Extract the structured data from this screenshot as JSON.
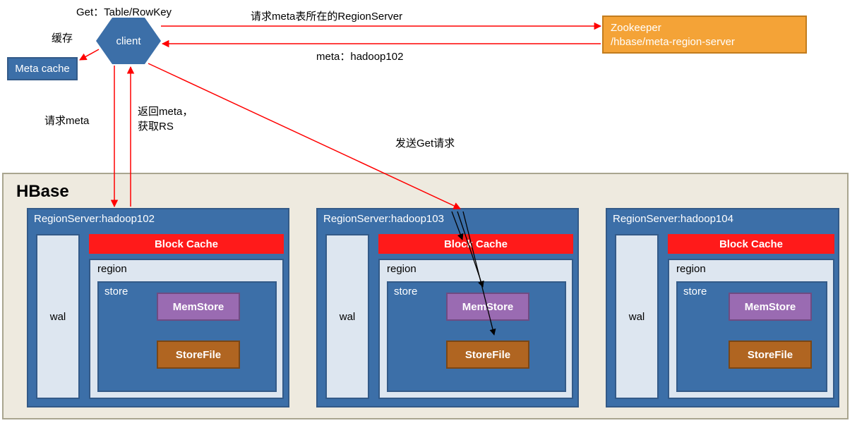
{
  "top": {
    "get_label": "Get：Table/RowKey",
    "req_zk": "请求meta表所在的RegionServer",
    "cache_label": "缓存",
    "client": "client",
    "meta_return": "meta：hadoop102",
    "zookeeper_line1": "Zookeeper",
    "zookeeper_line2": "/hbase/meta-region-server",
    "meta_cache": "Meta cache"
  },
  "mid": {
    "req_meta": "请求meta",
    "return_meta": "返回meta，\n获取RS",
    "send_get": "发送Get请求"
  },
  "hbase": {
    "title": "HBase"
  },
  "rs": {
    "block_cache": "Block Cache",
    "region": "region",
    "wal": "wal",
    "store": "store",
    "memstore": "MemStore",
    "storefile": "StoreFile",
    "servers": [
      {
        "title": "RegionServer:hadoop102"
      },
      {
        "title": "RegionServer:hadoop103"
      },
      {
        "title": "RegionServer:hadoop104"
      }
    ]
  }
}
